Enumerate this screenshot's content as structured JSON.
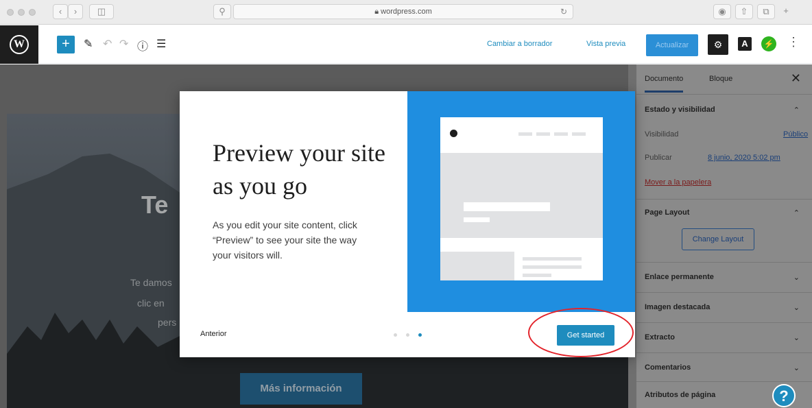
{
  "browser": {
    "url": "wordpress.com",
    "lock_icon": "lock-icon"
  },
  "toolbar": {
    "switch_to_draft": "Cambiar a borrador",
    "preview": "Vista previa",
    "update": "Actualizar",
    "a_label": "A"
  },
  "editor": {
    "hero_word": "Te",
    "hero_lines": [
      "Te damos",
      "clic en",
      "pers"
    ],
    "more_info": "Más información"
  },
  "sidebar": {
    "tabs": [
      "Documento",
      "Bloque"
    ],
    "status_visibility": "Estado y visibilidad",
    "visibility_label": "Visibilidad",
    "visibility_value": "Público",
    "publish_label": "Publicar",
    "publish_value": "8 junio, 2020 5:02 pm",
    "trash": "Mover a la papelera",
    "page_layout": "Page Layout",
    "change_layout": "Change Layout",
    "panels": [
      "Enlace permanente",
      "Imagen destacada",
      "Extracto",
      "Comentarios",
      "Atributos de página"
    ]
  },
  "modal": {
    "title": "Preview your site as you go",
    "body": "As you edit your site content, click “Preview” to see your site the way your visitors will.",
    "previous": "Anterior",
    "get_started": "Get started",
    "pages_total": 3,
    "current_page": 3
  },
  "colors": {
    "accent": "#1e8cbe",
    "annotation": "#e3242b",
    "art_bg": "#1f8ee0"
  }
}
